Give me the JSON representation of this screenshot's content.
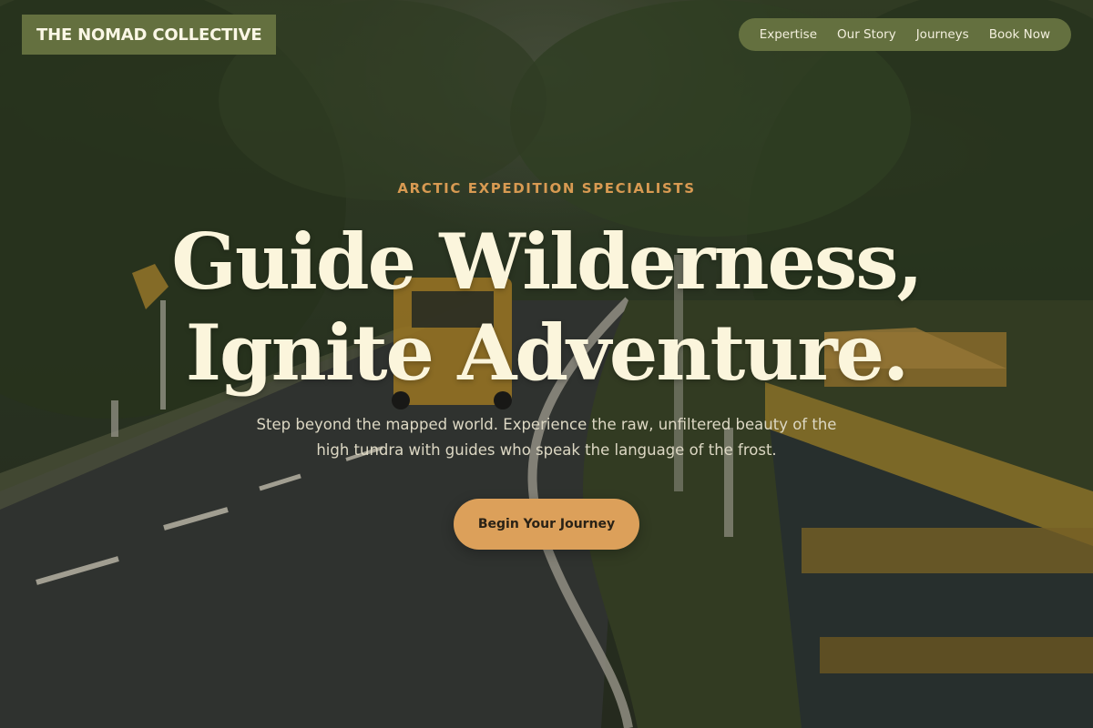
{
  "brand": {
    "name": "THE NOMAD COLLECTIVE"
  },
  "nav": {
    "items": [
      {
        "label": "Expertise"
      },
      {
        "label": "Our Story"
      },
      {
        "label": "Journeys"
      },
      {
        "label": "Book Now"
      }
    ]
  },
  "hero": {
    "eyebrow": "ARCTIC EXPEDITION SPECIALISTS",
    "headline_line1": "Guide Wilderness,",
    "headline_line2": "Ignite Adventure.",
    "subtitle": "Step beyond the mapped world. Experience the raw, unfiltered beauty of the high tundra with guides who speak the language of the frost.",
    "cta_label": "Begin Your Journey",
    "background_image": "forest-road-with-yellow-jeep"
  },
  "colors": {
    "brand_olive": "#64703f",
    "accent_amber": "#dca05a",
    "eyebrow_amber": "#d89a52",
    "headline_cream": "#fbf5dc"
  }
}
